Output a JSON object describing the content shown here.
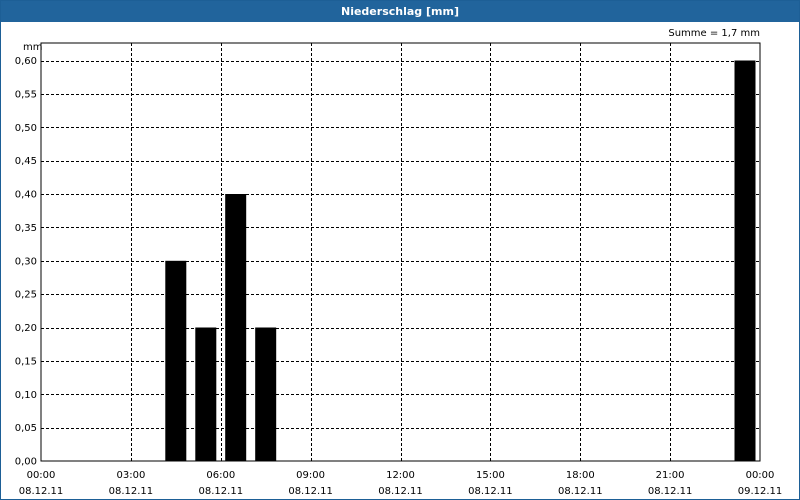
{
  "window": {
    "title": "Niederschlag [mm]"
  },
  "chart_data": {
    "type": "bar",
    "title": "Niederschlag [mm]",
    "ylabel": "mm",
    "summary": "Summe = 1,7 mm",
    "ylim": [
      0,
      0.6
    ],
    "xlim_hours": [
      0,
      24
    ],
    "y_ticks": [
      "0,00",
      "0,05",
      "0,10",
      "0,15",
      "0,20",
      "0,25",
      "0,30",
      "0,35",
      "0,40",
      "0,45",
      "0,50",
      "0,55",
      "0,60"
    ],
    "x_ticks": [
      {
        "time": "00:00",
        "date": "08.12.11"
      },
      {
        "time": "03:00",
        "date": "08.12.11"
      },
      {
        "time": "06:00",
        "date": "08.12.11"
      },
      {
        "time": "09:00",
        "date": "08.12.11"
      },
      {
        "time": "12:00",
        "date": "08.12.11"
      },
      {
        "time": "15:00",
        "date": "08.12.11"
      },
      {
        "time": "18:00",
        "date": "08.12.11"
      },
      {
        "time": "21:00",
        "date": "08.12.11"
      },
      {
        "time": "00:00",
        "date": "09.12.11"
      }
    ],
    "bars": [
      {
        "x": "08.12.11 05:00",
        "value": 0.3
      },
      {
        "x": "08.12.11 06:00",
        "value": 0.2
      },
      {
        "x": "08.12.11 07:00",
        "value": 0.4
      },
      {
        "x": "08.12.11 08:00",
        "value": 0.2
      },
      {
        "x": "09.12.11 00:00",
        "value": 0.6
      }
    ],
    "bar_color": "#000000",
    "grid": true
  }
}
